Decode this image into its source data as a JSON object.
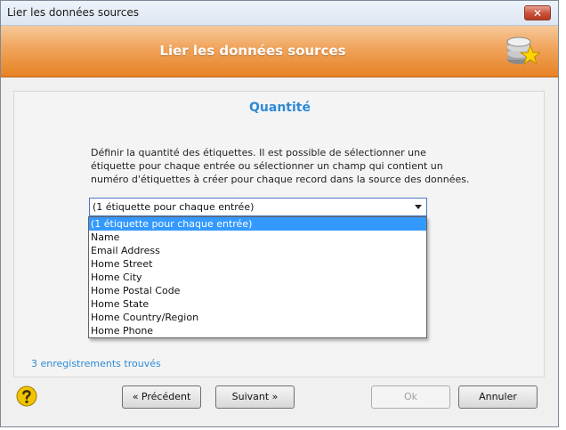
{
  "window": {
    "title": "Lier les données sources",
    "close_glyph": "✕"
  },
  "banner": {
    "title": "Lier les données sources",
    "icon": "database-star-icon"
  },
  "section": {
    "title": "Quantité"
  },
  "description": "Définir la quantité des étiquettes. Il est possible de sélectionner une étiquette pour chaque entrée ou sélectionner un champ qui contient un numéro d'étiquettes à créer pour chaque record dans la source des données.",
  "quantity_select": {
    "selected": "(1 étiquette pour chaque entrée)",
    "options": [
      "(1 étiquette pour chaque entrée)",
      "Name",
      "Email Address",
      "Home Street",
      "Home City",
      "Home Postal Code",
      "Home State",
      "Home Country/Region",
      "Home Phone"
    ]
  },
  "status": {
    "records_found": "3 enregistrements trouvés"
  },
  "buttons": {
    "previous": "« Précédent",
    "next": "Suivant »",
    "ok": "Ok",
    "cancel": "Annuler"
  },
  "colors": {
    "accent_orange": "#e68224",
    "link_blue": "#2e8bd6",
    "selection_blue": "#3399ff"
  }
}
